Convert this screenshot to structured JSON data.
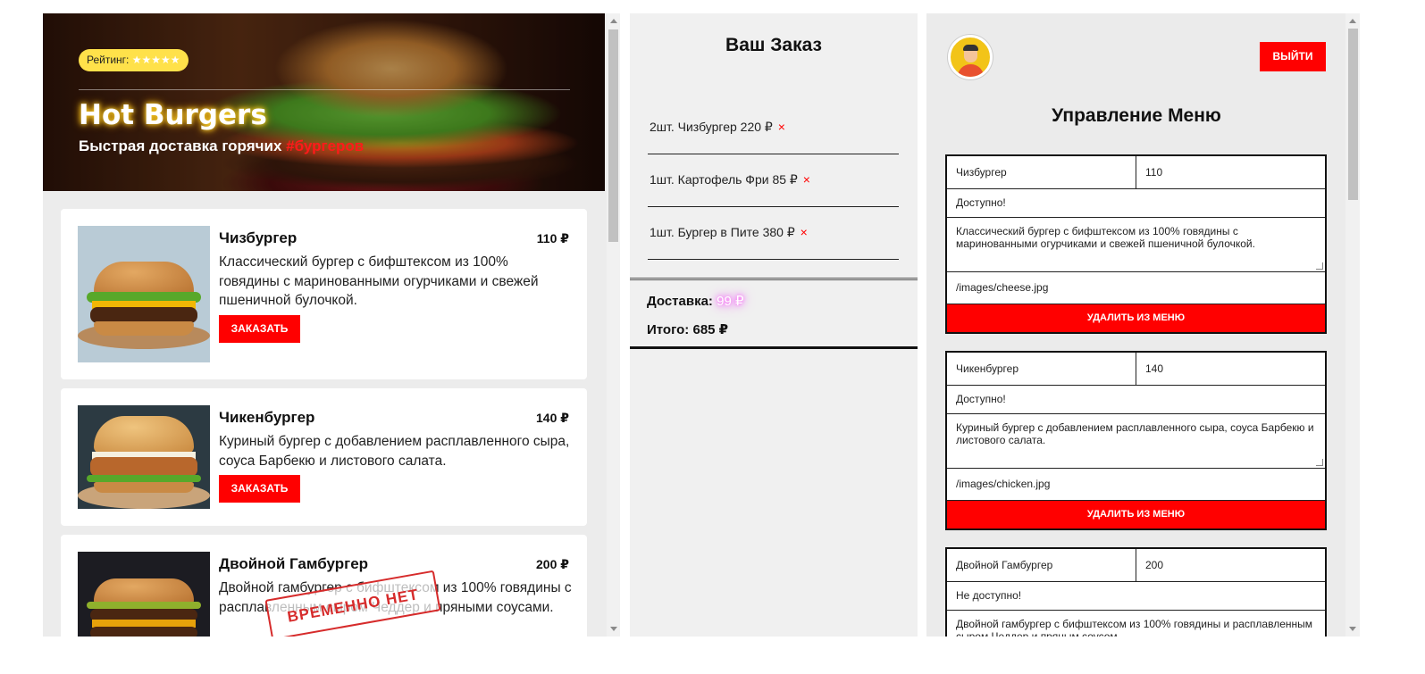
{
  "hero": {
    "rating_label": "Рейтинг:",
    "rating_stars": "★★★★★",
    "title": "Hot Burgers",
    "subtitle": "Быстрая доставка горячих",
    "subtitle_tag": "#бургеров"
  },
  "menu": {
    "items": [
      {
        "name": "Чизбургер",
        "price": "110 ₽",
        "desc": "Классический бургер с бифштексом из 100% говядины с маринованными огурчиками и свежей пшеничной булочкой.",
        "button": "ЗАКАЗАТЬ"
      },
      {
        "name": "Чикенбургер",
        "price": "140 ₽",
        "desc": "Куриный бургер с добавлением расплавленного сыра, соуса Барбекю и листового салата.",
        "button": "ЗАКАЗАТЬ"
      },
      {
        "name": "Двойной Гамбургер",
        "price": "200 ₽",
        "desc": "Двойной гамбургер с бифштексом из 100% говядины с расплавленным сыром Чеддер и пряными соусами.",
        "stamp": "ВРЕМЕННО НЕТ"
      }
    ]
  },
  "order": {
    "title": "Ваш Заказ",
    "items": [
      {
        "text": "2шт. Чизбургер 220 ₽",
        "remove": "×"
      },
      {
        "text": "1шт. Картофель Фри 85 ₽",
        "remove": "×"
      },
      {
        "text": "1шт. Бургер в Пите 380 ₽",
        "remove": "×"
      }
    ],
    "delivery_label": "Доставка:",
    "delivery_value": "99 ₽",
    "total_label": "Итого:",
    "total_value": "685 ₽"
  },
  "admin": {
    "logout": "ВЫЙТИ",
    "title": "Управление Меню",
    "forms": [
      {
        "name": "Чизбургер",
        "price": "110",
        "status": "Доступно!",
        "desc": "Классический бургер с бифштексом из 100% говядины с маринованными огурчиками и свежей пшеничной булочкой.",
        "image": "/images/cheese.jpg",
        "delete": "УДАЛИТЬ ИЗ МЕНЮ"
      },
      {
        "name": "Чикенбургер",
        "price": "140",
        "status": "Доступно!",
        "desc": "Куриный бургер с добавлением расплавленного сыра, соуса Барбекю и листового салата.",
        "image": "/images/chicken.jpg",
        "delete": "УДАЛИТЬ ИЗ МЕНЮ"
      },
      {
        "name": "Двойной Гамбургер",
        "price": "200",
        "status": "Не доступно!",
        "desc": "Двойной гамбургер с бифштексом из 100% говядины и расплавленным сыром Чеддер и пряным соусом."
      }
    ]
  },
  "colors": {
    "accent": "#ff0000",
    "rating_pill": "#ffe14a",
    "panel_bg": "#ececec"
  }
}
